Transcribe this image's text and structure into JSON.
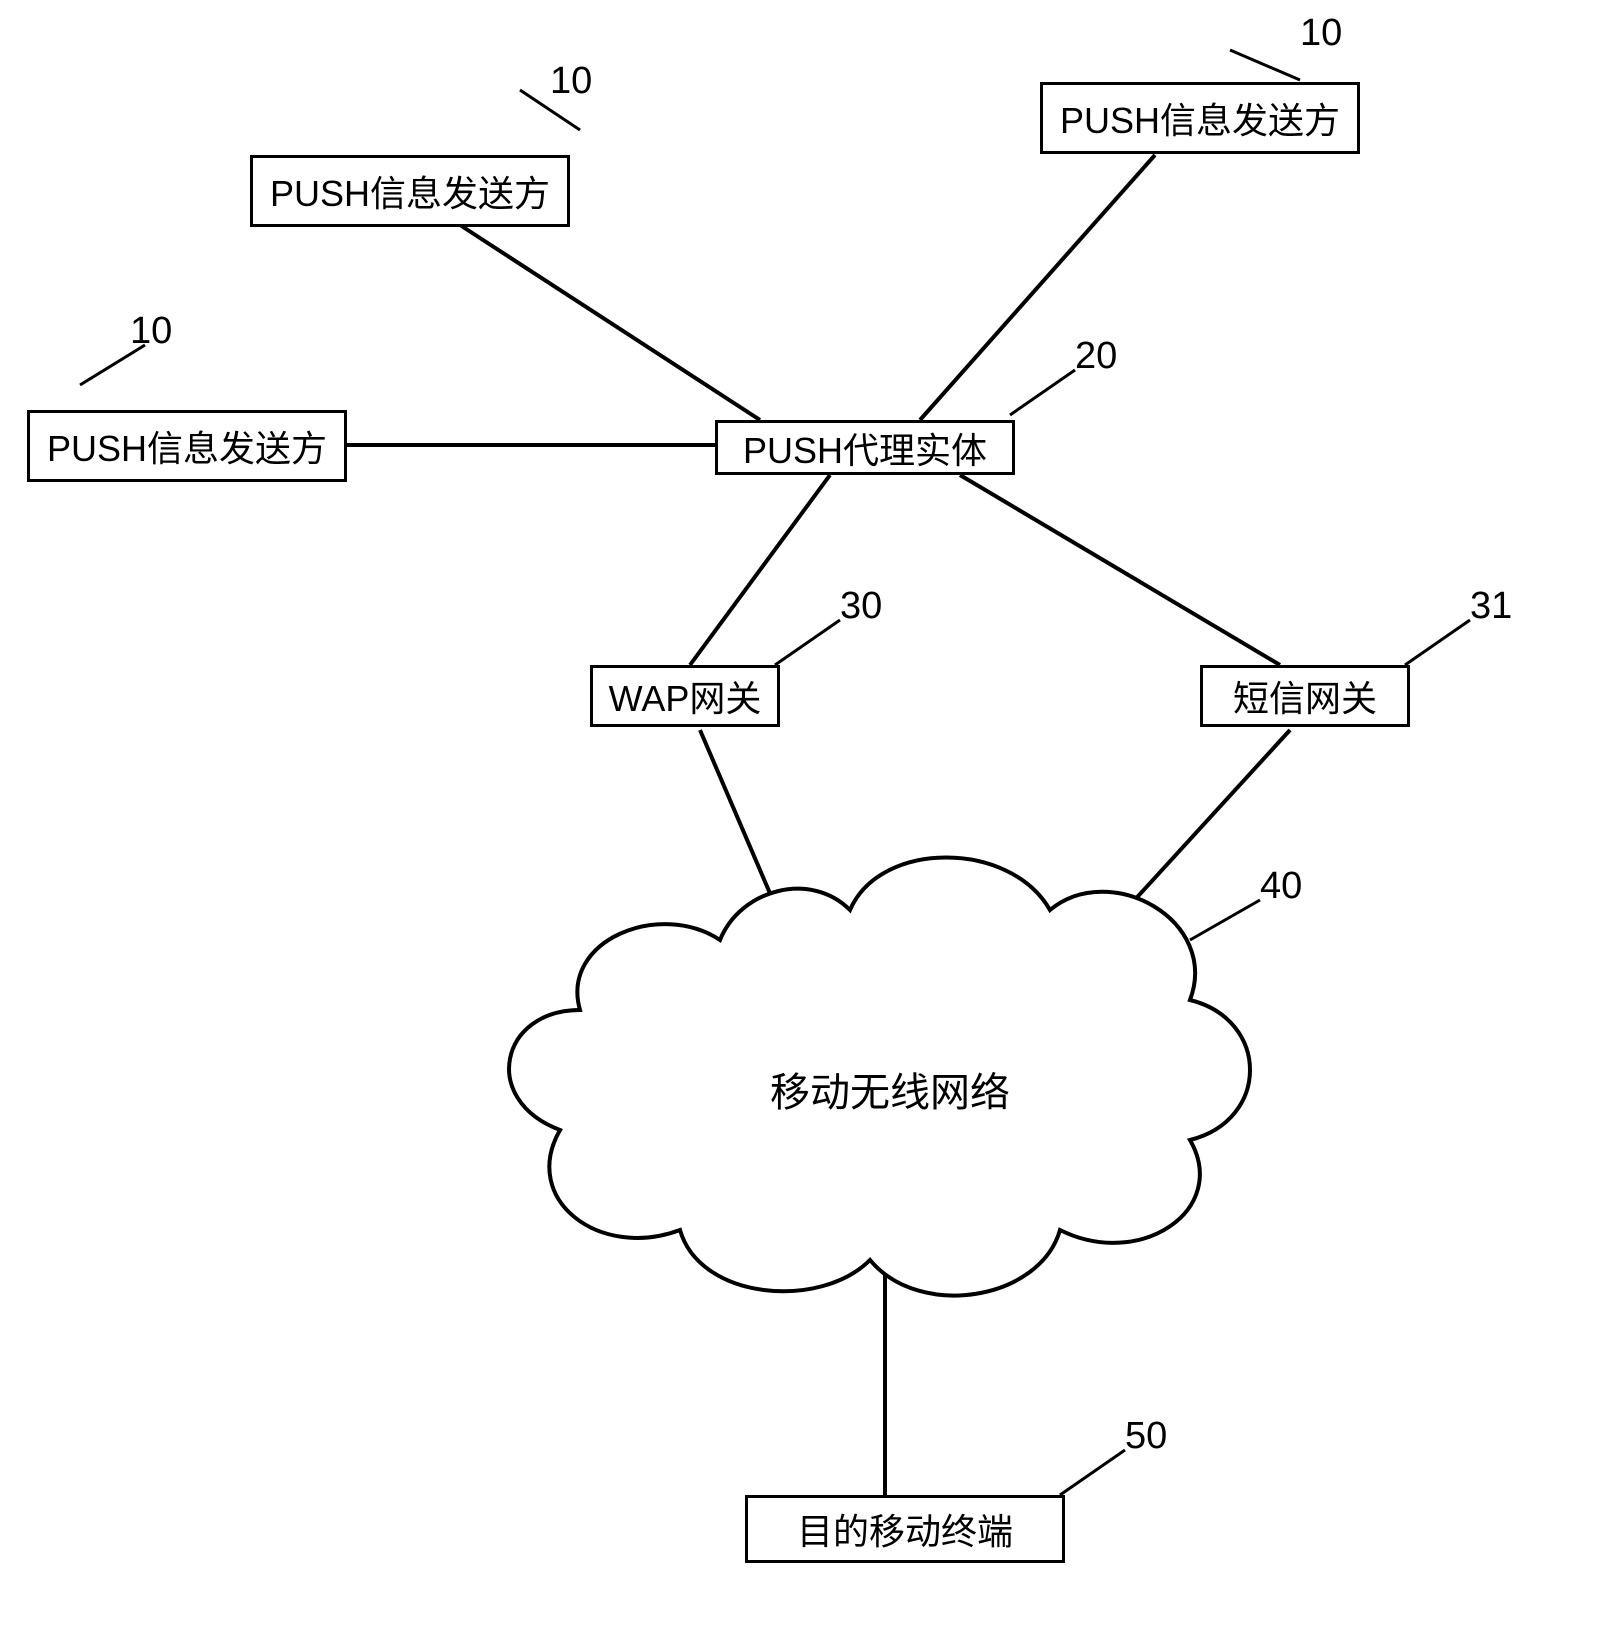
{
  "nodes": {
    "sender1": {
      "label": "PUSH信息发送方",
      "ref": "10"
    },
    "sender2": {
      "label": "PUSH信息发送方",
      "ref": "10"
    },
    "sender3": {
      "label": "PUSH信息发送方",
      "ref": "10"
    },
    "proxy": {
      "label": "PUSH代理实体",
      "ref": "20"
    },
    "wap": {
      "label": "WAP网关",
      "ref": "30"
    },
    "sms": {
      "label": "短信网关",
      "ref": "31"
    },
    "cloud": {
      "label": "移动无线网络",
      "ref": "40"
    },
    "terminal": {
      "label": "目的移动终端",
      "ref": "50"
    }
  }
}
